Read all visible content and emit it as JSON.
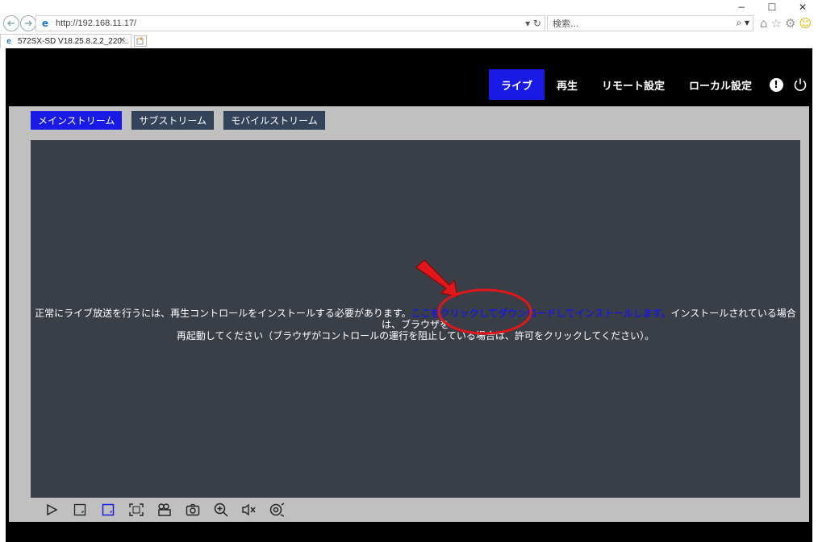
{
  "window": {
    "minimize": "−",
    "maximize": "☐",
    "close": "✕"
  },
  "browser": {
    "url": "http://192.168.11.17/",
    "search_placeholder": "検索...",
    "tab_title": "572SX-SD V18.25.8.2.2_220...",
    "tab_close": "✕"
  },
  "topnav": {
    "items": [
      {
        "label": "ライブ",
        "active": true
      },
      {
        "label": "再生",
        "active": false
      },
      {
        "label": "リモート設定",
        "active": false
      },
      {
        "label": "ローカル設定",
        "active": false
      }
    ],
    "alert_glyph": "!",
    "power_glyph": "⏻"
  },
  "streams": {
    "tabs": [
      {
        "label": "メインストリーム",
        "active": true
      },
      {
        "label": "サブストリーム",
        "active": false
      },
      {
        "label": "モバイルストリーム",
        "active": false
      }
    ]
  },
  "message": {
    "prefix": "正常にライブ放送を行うには、再生コントロールをインストールする必要があります。",
    "link": "ここをクリックしてダウンロードしてインストールします。",
    "suffix": "インストールされている場合は、ブラウザを",
    "line2": "再起動してください（ブラウザがコントロールの運行を阻止している場合は、許可をクリックしてください）。"
  },
  "colors": {
    "active_blue": "#1a1ae6",
    "stream_tab": "#33435a",
    "video_bg": "#3a3f47",
    "panel_bg": "#c0c0c0",
    "annotation_red": "#e0161b"
  },
  "controls": [
    "play-icon",
    "single-view-icon",
    "fit-view-icon",
    "fullscreen-icon",
    "record-icon",
    "snapshot-icon",
    "zoom-in-icon",
    "mute-icon",
    "ptz-icon"
  ]
}
